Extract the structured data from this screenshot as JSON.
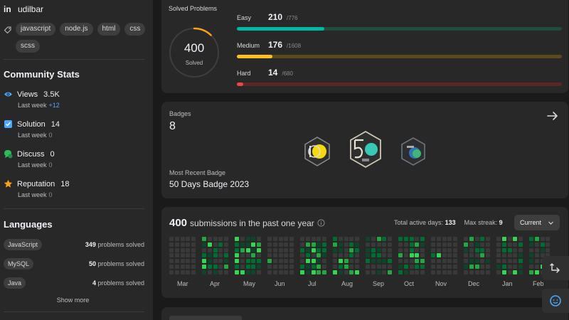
{
  "profile": {
    "linkedin_icon": "linkedin-icon",
    "linkedin_handle": "udilbar",
    "skill_tags": [
      "javascript",
      "node.js",
      "html",
      "css",
      "scss"
    ]
  },
  "community_stats": {
    "title": "Community Stats",
    "items": [
      {
        "label": "Views",
        "value": "3.5K",
        "sub_label": "Last week",
        "delta": "+12",
        "color": "#4aa8ff",
        "icon": "eye-icon"
      },
      {
        "label": "Solution",
        "value": "14",
        "sub_label": "Last week",
        "delta": "0",
        "color": "#4aa8ff",
        "icon": "checkbox-icon"
      },
      {
        "label": "Discuss",
        "value": "0",
        "sub_label": "Last week",
        "delta": "0",
        "color": "#2cbb5d",
        "icon": "chat-icon"
      },
      {
        "label": "Reputation",
        "value": "18",
        "sub_label": "Last week",
        "delta": "0",
        "color": "#ffa116",
        "icon": "star-icon"
      }
    ]
  },
  "languages": {
    "title": "Languages",
    "items": [
      {
        "name": "JavaScript",
        "count": "349",
        "suffix": "problems solved"
      },
      {
        "name": "MySQL",
        "count": "50",
        "suffix": "problems solved"
      },
      {
        "name": "Java",
        "count": "4",
        "suffix": "problems solved"
      }
    ],
    "show_more": "Show more"
  },
  "solved": {
    "title": "Solved Problems",
    "total": "400",
    "total_label": "Solved",
    "ring_fraction": 0.122,
    "levels": [
      {
        "label": "Easy",
        "count": "210",
        "total": "/776",
        "fraction": 0.27,
        "color": "#00b8a3",
        "track": "#204c3c"
      },
      {
        "label": "Medium",
        "count": "176",
        "total": "/1608",
        "fraction": 0.11,
        "color": "#ffc01e",
        "track": "#5b4a1c"
      },
      {
        "label": "Hard",
        "count": "14",
        "total": "/680",
        "fraction": 0.02,
        "color": "#ef4743",
        "track": "#5a2626"
      }
    ]
  },
  "badges": {
    "title": "Badges",
    "count": "8",
    "recent_title": "Most Recent Badge",
    "recent_name": "50 Days Badge 2023",
    "badge_number": "50"
  },
  "submissions": {
    "count": "400",
    "text": "submissions in the past one year",
    "active_days_label": "Total active days:",
    "active_days": "133",
    "max_streak_label": "Max streak:",
    "max_streak": "9",
    "range_selector": "Current",
    "months": [
      "Mar",
      "Apr",
      "May",
      "Jun",
      "Jul",
      "Aug",
      "Sep",
      "Oct",
      "Nov",
      "Dec",
      "Jan",
      "Feb"
    ]
  }
}
